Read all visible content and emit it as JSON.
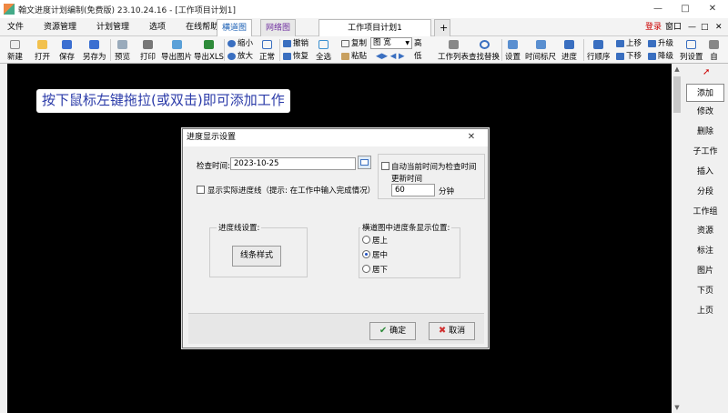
{
  "window": {
    "title": "翰文进度计划编制(免费版) 23.10.24.16 - [工作项目计划1]",
    "controls": [
      "—",
      "□",
      "✕"
    ]
  },
  "menubar": {
    "items": [
      "文件",
      "资源管理",
      "计划管理",
      "选项",
      "在线帮助"
    ],
    "tabs": [
      "横道图",
      "网络图",
      "工作项目计划1"
    ],
    "add_tab": "+",
    "right_items": [
      "登录",
      "窗口",
      "—",
      "□",
      "✕"
    ]
  },
  "toolbar": {
    "buttons": [
      "新建",
      "打开",
      "保存",
      "另存为",
      "预览",
      "打印",
      "导出图片",
      "导出XLS"
    ],
    "zoom": {
      "shrink": "缩小",
      "enlarge": "放大",
      "normal": "正常"
    },
    "undo": "撤销",
    "redo": "恢复",
    "select_all": "全选",
    "copy": "复制",
    "paste": "粘贴",
    "view_select": "图 宽",
    "high": "高",
    "low": "低",
    "task_list": "工作列表",
    "find_replace": "查找替换",
    "settings": "设置",
    "time_ruler": "时间标尺",
    "progress": "进度",
    "row_order": "行顺序",
    "move_up": "上移",
    "move_down": "下移",
    "upgrade": "升级",
    "downgrade": "降级",
    "col_settings": "列设置",
    "more": "自"
  },
  "canvas": {
    "hint": "按下鼠标左键拖拉(或双击)即可添加工作"
  },
  "sidebar": {
    "items": [
      "添加",
      "修改",
      "删除",
      "子工作",
      "插入",
      "分段",
      "工作组",
      "资源",
      "标注",
      "图片",
      "下页",
      "上页"
    ]
  },
  "dialog": {
    "title": "进度显示设置",
    "check_time_label": "检查时间:",
    "check_time_value": "2023-10-25",
    "auto_now_label": "自动当前时间为检查时间",
    "update_time_label": "更新时间",
    "update_value": "60",
    "update_unit": "分钟",
    "show_actual_label": "显示实际进度线（提示: 在工作中输入完成情况）",
    "line_settings_label": "进度线设置:",
    "line_style_button": "线条样式",
    "position_label": "横道图中进度条显示位置:",
    "positions": [
      "居上",
      "居中",
      "居下"
    ],
    "selected_position": "居中",
    "ok": "确定",
    "cancel": "取消"
  },
  "colors": {
    "canvas": "#000000",
    "hint_text": "#2a3aa8",
    "dialog_bg": "#f0f0f0"
  }
}
